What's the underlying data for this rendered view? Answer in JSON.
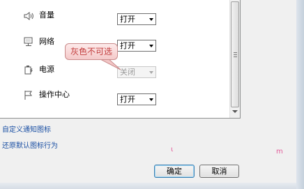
{
  "rows": [
    {
      "icon": "speaker-icon",
      "label": "音量",
      "value": "打开",
      "disabled": false
    },
    {
      "icon": "network-icon",
      "label": "网络",
      "value": "打开",
      "disabled": false
    },
    {
      "icon": "power-icon",
      "label": "电源",
      "value": "关闭",
      "disabled": true
    },
    {
      "icon": "action-center-flag-icon",
      "label": "操作中心",
      "value": "打开",
      "disabled": false
    }
  ],
  "callout": {
    "text": "灰色不可选"
  },
  "links": {
    "customize": "自定义通知图标",
    "restore": "还原默认图标行为"
  },
  "buttons": {
    "ok": "确定",
    "cancel": "取消"
  },
  "colors": {
    "link": "#1a4fa3",
    "callout_text": "#c23c3c",
    "callout_bg": "#f6d3d3"
  }
}
